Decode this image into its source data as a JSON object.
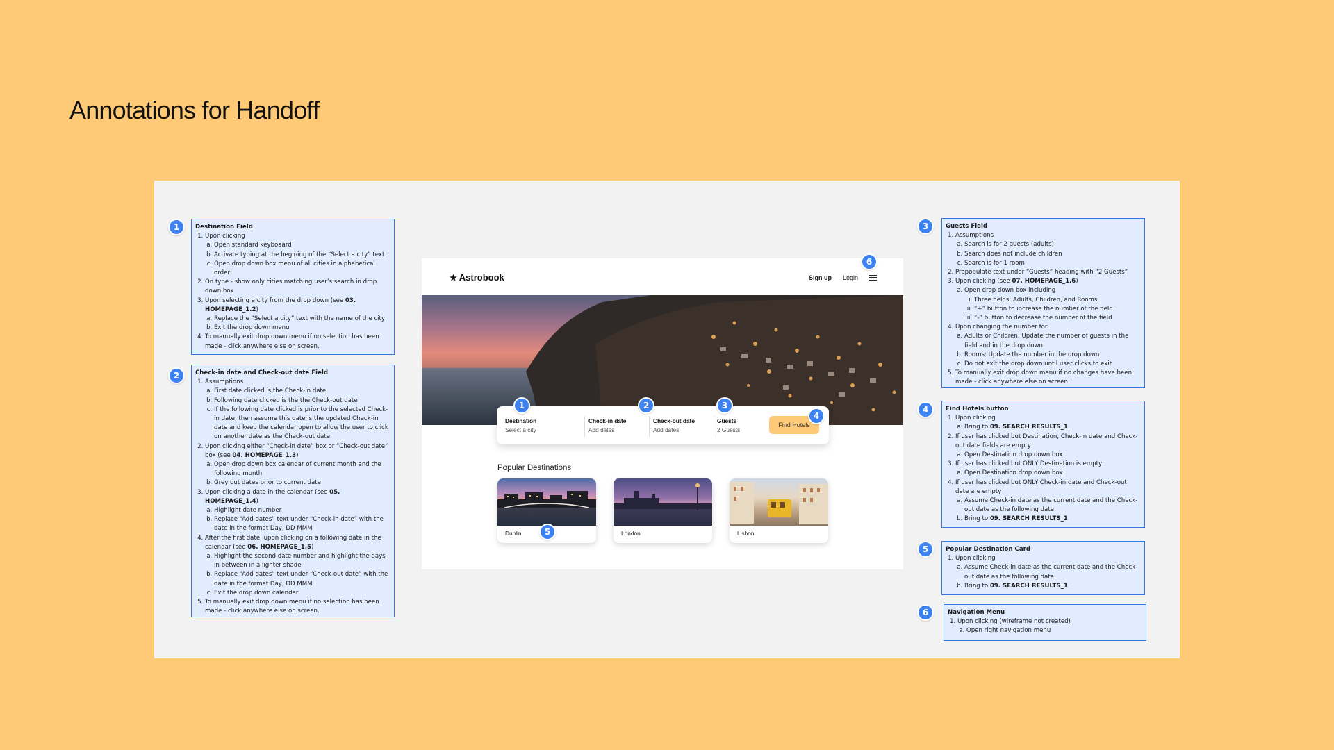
{
  "heading": "Annotations for Handoff",
  "wireframe": {
    "logo": "Astrobook",
    "nav": {
      "signup": "Sign up",
      "login": "Login"
    },
    "search": {
      "destination_label": "Destination",
      "destination_value": "Select a city",
      "checkin_label": "Check-in date",
      "checkin_value": "Add dates",
      "checkout_label": "Check-out date",
      "checkout_value": "Add dates",
      "guests_label": "Guests",
      "guests_value": "2 Guests",
      "find_button": "Find Hotels"
    },
    "popular_title": "Popular Destinations",
    "destinations": [
      "Dublin",
      "London",
      "Lisbon"
    ]
  },
  "badges": [
    "1",
    "2",
    "3",
    "4",
    "5",
    "6"
  ],
  "annotations": {
    "destination": {
      "title": "Destination Field",
      "i1": "Upon clicking",
      "i1a": "Open standard keyboaard",
      "i1b": "Activate typing at the begining of the “Select a city” text",
      "i1c": "Open drop down box menu of all cities in alphabetical order",
      "i2": "On type - show only cities matching user’s search in drop down box",
      "i3_pre": "Upon selecting a city from the drop down (see ",
      "i3_ref": "03. HOMEPAGE_1.2",
      "i3_post": ")",
      "i3a": "Replace the “Select a city” text with the name of the city",
      "i3b": "Exit the drop down menu",
      "i4": "To manually exit drop down menu if no selection has been made - click anywhere else on screen."
    },
    "dates": {
      "title": "Check-in date and Check-out date Field",
      "i1": "Assumptions",
      "i1a": "First date clicked is the Check-in date",
      "i1b": "Following date clicked is the the Check-out date",
      "i1c": "If the following date clicked is prior to the selected Check-in date, then assume this date is the updated Check-in date and keep the calendar open to allow the user to click on another date as the Check-out date",
      "i2_pre": "Upon clicking either “Check-in date” box or “Check-out date” box (see ",
      "i2_ref": "04. HOMEPAGE_1.3",
      "i2_post": ")",
      "i2a": "Open drop down box calendar of current month and the following month",
      "i2b": "Grey out dates prior to current date",
      "i3_pre": "Upon clicking a date in the calendar (see ",
      "i3_ref": "05. HOMEPAGE_1.4",
      "i3_post": ")",
      "i3a": "Highlight date number",
      "i3b": "Replace “Add dates” text under “Check-in date” with the date in the format Day, DD MMM",
      "i4_pre": "After the first date, upon clicking on a following date in the calendar (see ",
      "i4_ref": "06. HOMEPAGE_1.5",
      "i4_post": ")",
      "i4a": "Highlight the second date number and highlight the days in between in a lighter shade",
      "i4b": "Replace “Add dates” text under “Check-out date” with the date in the format Day, DD MMM",
      "i4c": "Exit the drop down calendar",
      "i5": "To manually exit drop down menu if no selection has been made - click anywhere else on screen."
    },
    "guests": {
      "title": "Guests Field",
      "i1": "Assumptions",
      "i1a": "Search is for 2 guests (adults)",
      "i1b": "Search does not include children",
      "i1c": "Search is for 1 room",
      "i2": "Prepopulate text under “Guests” heading with “2 Guests”",
      "i3_pre": "Upon clicking (see ",
      "i3_ref": "07. HOMEPAGE_1.6",
      "i3_post": ")",
      "i3a": "Open drop down box including",
      "i3a1": "Three fields; Adults, Children, and Rooms",
      "i3a2": "“+” button to increase the number of the field",
      "i3a3": "“-” button to decrease the number of the field",
      "i4": "Upon changing the number for",
      "i4a": "Adults or Children: Update the number of guests in the field and in the drop down",
      "i4b": "Rooms: Update the number in the drop down",
      "i4c": "Do not exit the drop down until user clicks to exit",
      "i5": "To manually exit drop down menu if no changes have been made - click anywhere else on screen."
    },
    "find": {
      "title": "Find Hotels button",
      "i1": "Upon clicking",
      "i1a_pre": "Bring to ",
      "i1a_ref": "09. SEARCH RESULTS_1",
      "i1a_post": ".",
      "i2": "If user has clicked but Destination, Check-in date and Check-out date fields are empty",
      "i2a": "Open Destination drop down box",
      "i3": "If user has clicked but ONLY Destination is empty",
      "i3a": "Open Destination drop down box",
      "i4": "If user has clicked but ONLY Check-in date and Check-out date are empty",
      "i4a": "Assume Check-in date as the current date and the Check-out date as the following date",
      "i4b_pre": "Bring to ",
      "i4b_ref": "09. SEARCH RESULTS_1"
    },
    "popular": {
      "title": "Popular Destination Card",
      "i1": "Upon clicking",
      "i1a": "Assume Check-in date as the current date and the Check-out date as the following date",
      "i1b_pre": "Bring to ",
      "i1b_ref": "09. SEARCH RESULTS_1"
    },
    "nav": {
      "title": "Navigation Menu",
      "i1": "Upon clicking (wireframe not created)",
      "i1a": "Open right navigation menu"
    }
  }
}
